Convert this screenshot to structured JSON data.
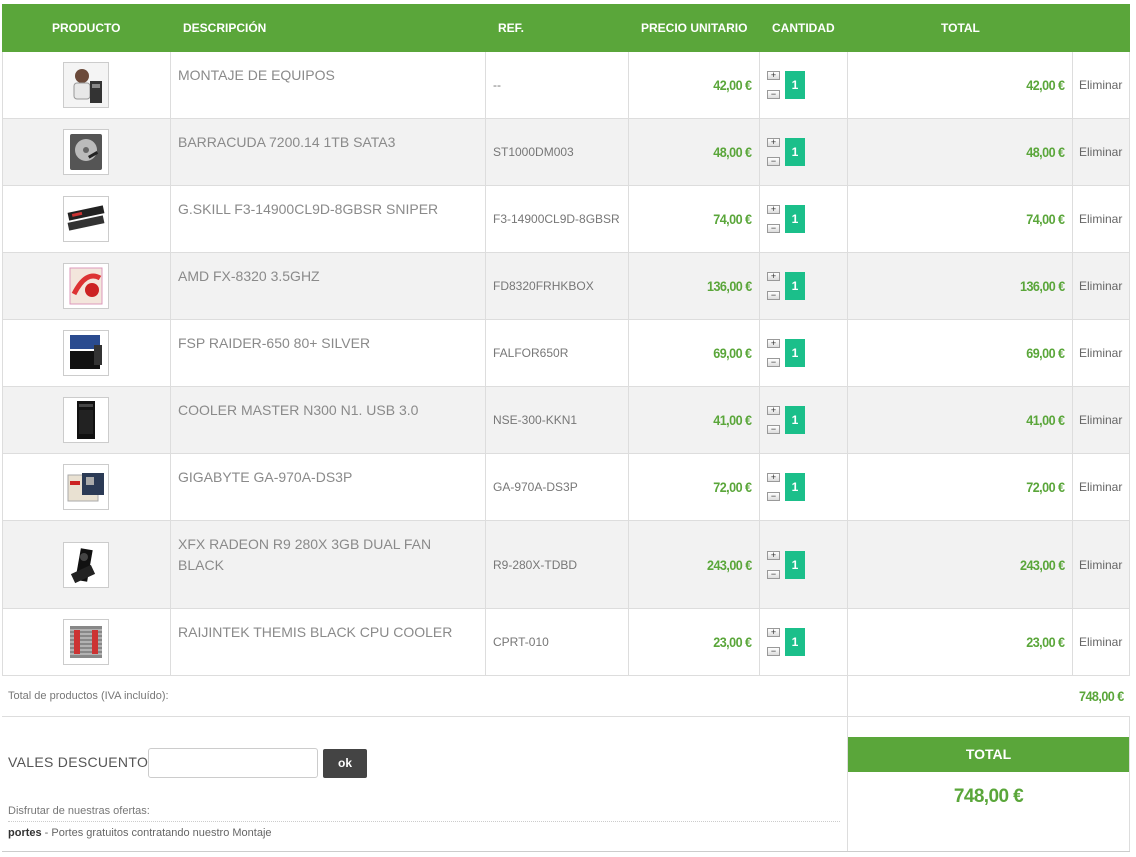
{
  "columns": {
    "product": "PRODUCTO",
    "description": "DESCRIPCIÓN",
    "ref": "REF.",
    "unit_price": "PRECIO UNITARIO",
    "quantity": "CANTIDAD",
    "total": "TOTAL"
  },
  "items": [
    {
      "icon": "technician-image",
      "name": "MONTAJE DE EQUIPOS",
      "ref": "--",
      "price": "42,00 €",
      "qty": "1",
      "total": "42,00 €",
      "remove": "Eliminar"
    },
    {
      "icon": "hard-drive-image",
      "name": "BARRACUDA 7200.14 1TB SATA3",
      "ref": "ST1000DM003",
      "price": "48,00 €",
      "qty": "1",
      "total": "48,00 €",
      "remove": "Eliminar"
    },
    {
      "icon": "ram-image",
      "name": "G.SKILL F3-14900CL9D-8GBSR SNIPER",
      "ref": "F3-14900CL9D-8GBSR",
      "price": "74,00 €",
      "qty": "1",
      "total": "74,00 €",
      "remove": "Eliminar"
    },
    {
      "icon": "cpu-box-image",
      "name": "AMD FX-8320 3.5GHZ",
      "ref": "FD8320FRHKBOX",
      "price": "136,00 €",
      "qty": "1",
      "total": "136,00 €",
      "remove": "Eliminar"
    },
    {
      "icon": "psu-image",
      "name": "FSP RAIDER-650 80+ SILVER",
      "ref": "FALFOR650R",
      "price": "69,00 €",
      "qty": "1",
      "total": "69,00 €",
      "remove": "Eliminar"
    },
    {
      "icon": "pc-case-image",
      "name": "COOLER MASTER N300 N1. USB 3.0",
      "ref": "NSE-300-KKN1",
      "price": "41,00 €",
      "qty": "1",
      "total": "41,00 €",
      "remove": "Eliminar"
    },
    {
      "icon": "motherboard-image",
      "name": "GIGABYTE GA-970A-DS3P",
      "ref": "GA-970A-DS3P",
      "price": "72,00 €",
      "qty": "1",
      "total": "72,00 €",
      "remove": "Eliminar"
    },
    {
      "icon": "graphics-card-image",
      "name": "XFX RADEON R9 280X 3GB DUAL FAN BLACK",
      "ref": "R9-280X-TDBD",
      "price": "243,00 €",
      "qty": "1",
      "total": "243,00 €",
      "remove": "Eliminar"
    },
    {
      "icon": "cpu-cooler-image",
      "name": "RAIJINTEK THEMIS BLACK CPU COOLER",
      "ref": "CPRT-010",
      "price": "23,00 €",
      "qty": "1",
      "total": "23,00 €",
      "remove": "Eliminar"
    }
  ],
  "qty_controls": {
    "increase": "+",
    "decrease": "−"
  },
  "subtotal": {
    "label": "Total de productos (IVA incluído):",
    "value": "748,00 €"
  },
  "voucher": {
    "label": "VALES DESCUENTO",
    "input_value": "",
    "button": "ok"
  },
  "offers": {
    "label": "Disfrutar de nuestras ofertas:",
    "code": "portes",
    "text": " - Portes gratuitos contratando nuestro Montaje"
  },
  "grand_total": {
    "label": "TOTAL",
    "value": "748,00 €"
  },
  "colors": {
    "accent": "#5aa63a",
    "qty_badge": "#1bbf8a"
  }
}
